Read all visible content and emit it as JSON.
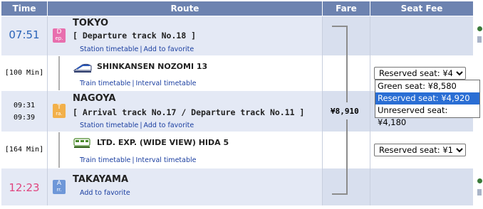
{
  "header": {
    "time": "Time",
    "route": "Route",
    "fare": "Fare",
    "seat_fee": "Seat Fee"
  },
  "stops": [
    {
      "time": "07:51",
      "badge_top": "D",
      "badge_bottom": "ep.",
      "badge_color": "#e86fae",
      "station": "TOKYO",
      "track": "[ Departure track No.18 ]",
      "link1": "Station timetable",
      "link2": "Add to favorite"
    },
    {
      "time_arr": "09:31",
      "time_dep": "09:39",
      "badge_top": "T",
      "badge_bottom": "ra.",
      "badge_color": "#f2b04a",
      "station": "NAGOYA",
      "track": "[ Arrival track No.17 / Departure track No.11 ]",
      "link1": "Station timetable",
      "link2": "Add to favorite"
    },
    {
      "time": "12:23",
      "badge_top": "A",
      "badge_bottom": "rr.",
      "badge_color": "#6e97d8",
      "station": "TAKAYAMA",
      "link2": "Add to favorite"
    }
  ],
  "legs": [
    {
      "duration": "[100 Min]",
      "train": "SHINKANSEN NOZOMI 13",
      "icon": "shinkansen-icon",
      "link1": "Train timetable",
      "link2": "Interval timetable",
      "seat_selected": "Reserved seat: ¥4"
    },
    {
      "duration": "[164 Min]",
      "train": "LTD. EXP. (WIDE VIEW) HIDA 5",
      "icon": "limited-express-icon",
      "link1": "Train timetable",
      "link2": "Interval timetable",
      "seat_selected": "Reserved seat: ¥1"
    }
  ],
  "fare": "¥8,910",
  "seat_dropdown": {
    "options": [
      "Green seat: ¥8,580",
      "Reserved seat: ¥4,920",
      "Unreserved seat: ¥4,180"
    ],
    "highlighted": "Reserved seat: ¥4,920"
  },
  "colors": {
    "header": "#6d83b0",
    "time_blue": "#2a63b8",
    "time_pink": "#e0457f",
    "link": "#1a3ea0"
  }
}
